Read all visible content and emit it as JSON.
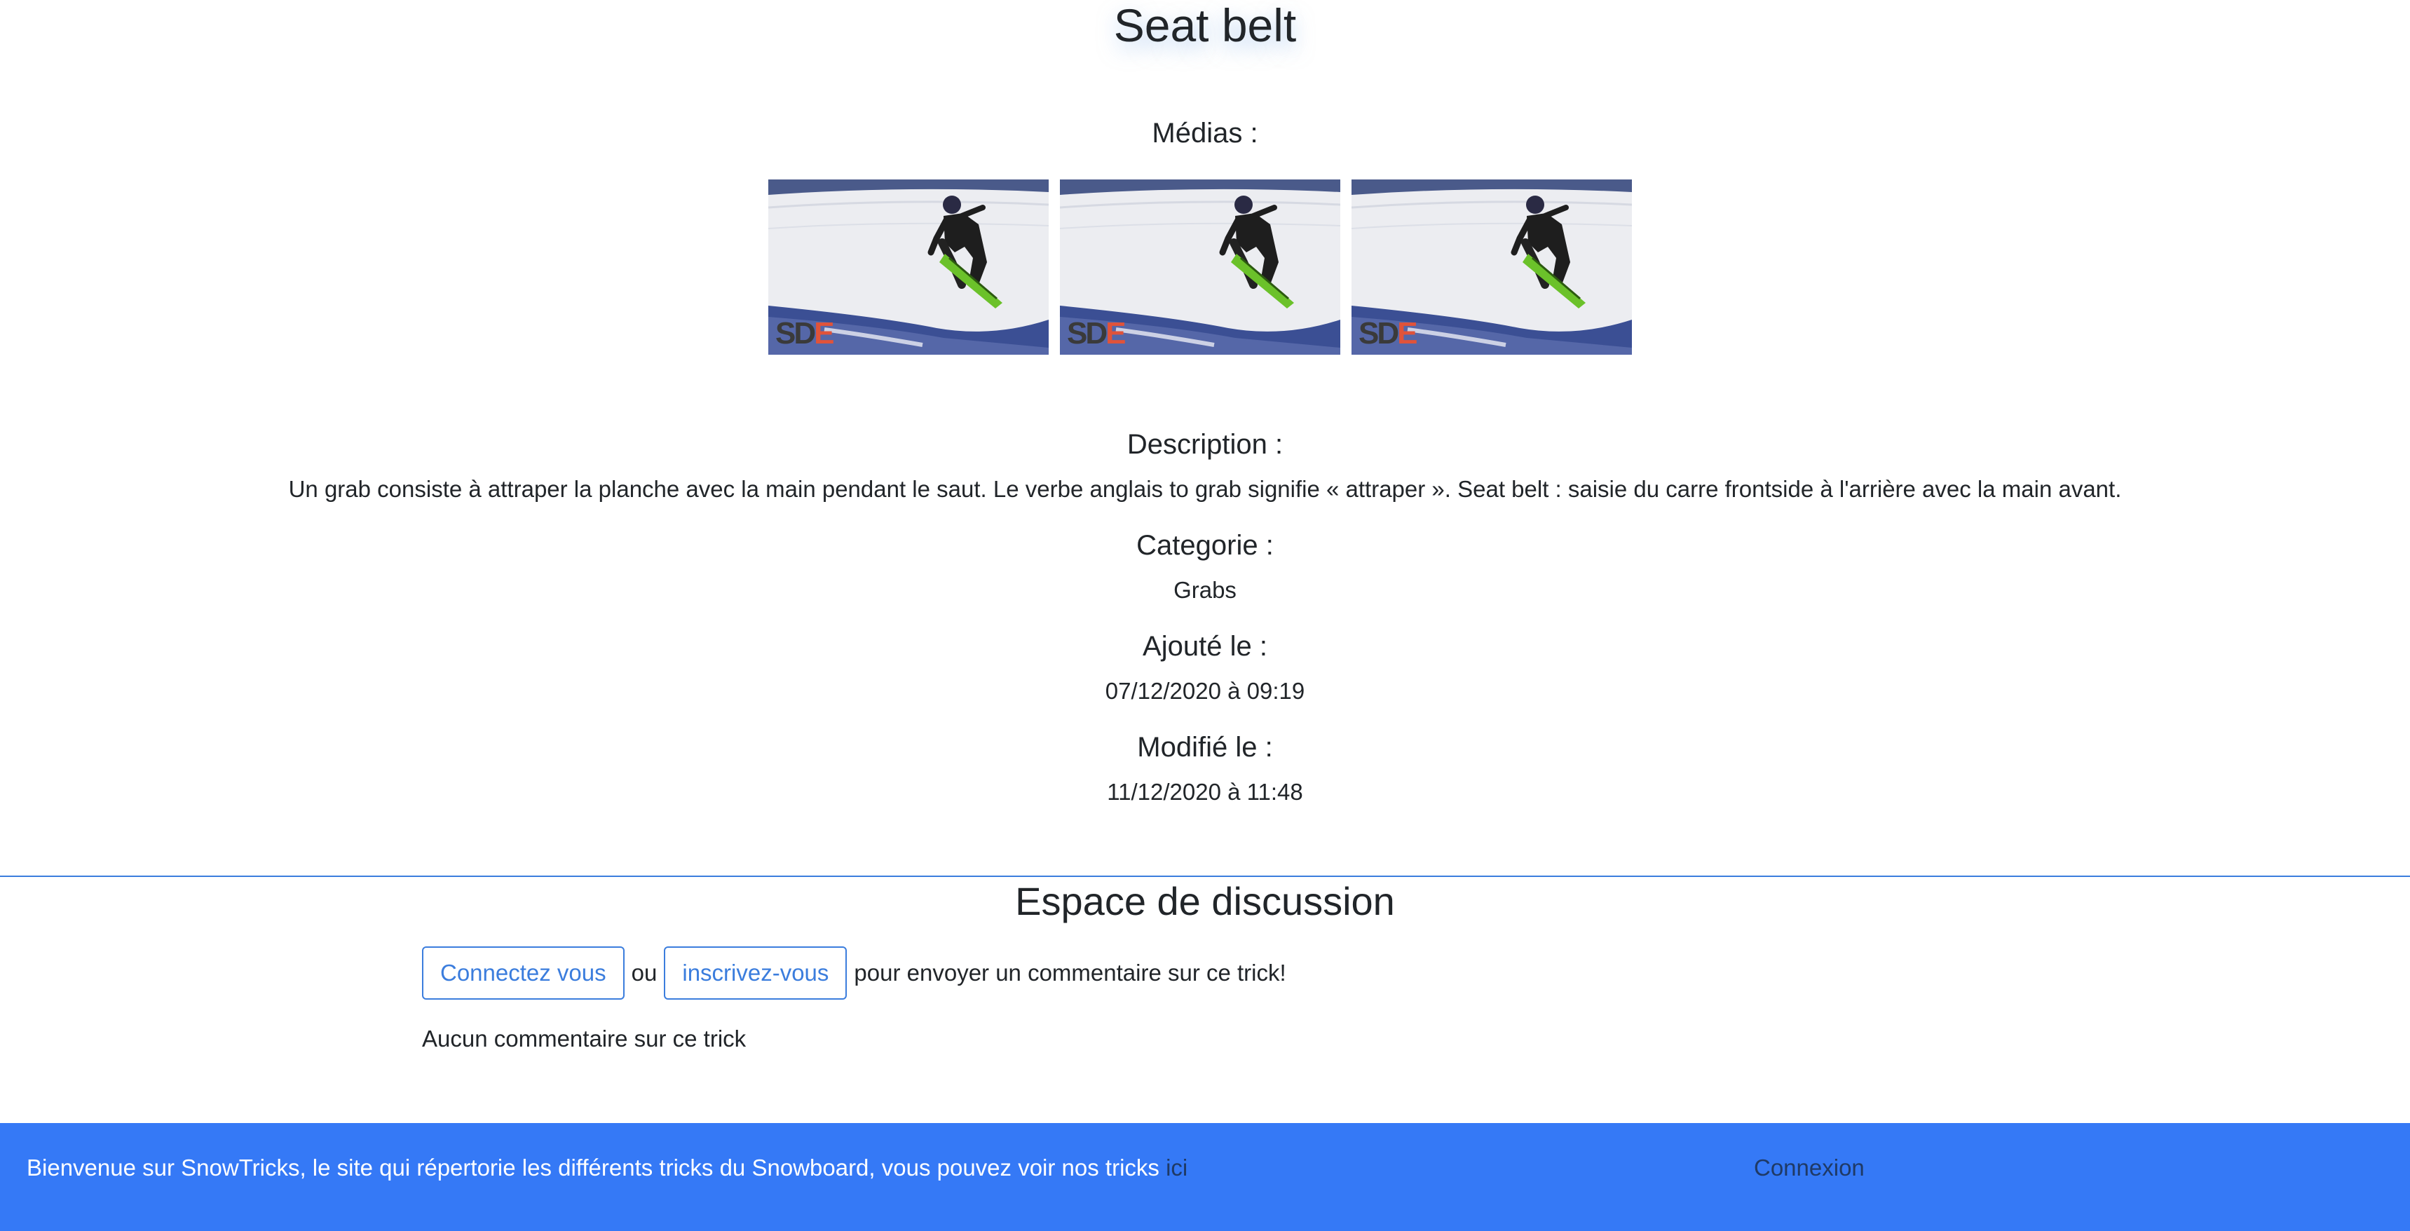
{
  "trick": {
    "title": "Seat belt"
  },
  "medias": {
    "heading": "Médias :",
    "items": [
      {
        "watermark_s": "SD",
        "watermark_e": "E"
      },
      {
        "watermark_s": "SD",
        "watermark_e": "E"
      },
      {
        "watermark_s": "SD",
        "watermark_e": "E"
      }
    ]
  },
  "description": {
    "heading": "Description :",
    "text": "Un grab consiste à attraper la planche avec la main pendant le saut. Le verbe anglais to grab signifie « attraper ». Seat belt : saisie du carre frontside à l'arrière avec la main avant."
  },
  "category": {
    "heading": "Categorie :",
    "value": "Grabs"
  },
  "added": {
    "heading": "Ajouté le :",
    "value": "07/12/2020 à 09:19"
  },
  "modified": {
    "heading": "Modifié le :",
    "value": "11/12/2020 à 11:48"
  },
  "discussion": {
    "title": "Espace de discussion",
    "login_button": "Connectez vous",
    "or_text": "ou",
    "register_button": "inscrivez-vous",
    "prompt_text": "pour envoyer un commentaire sur ce trick!",
    "no_comment": "Aucun commentaire sur ce trick"
  },
  "footer": {
    "text": "Bienvenue sur SnowTricks, le site qui répertorie les différents tricks du Snowboard, vous pouvez voir nos tricks",
    "link": "ici",
    "login": "Connexion"
  },
  "colors": {
    "primary": "#3b7ddd",
    "footer_bg": "#3579f6",
    "text": "#212529",
    "watermark_e": "#e0533a"
  }
}
